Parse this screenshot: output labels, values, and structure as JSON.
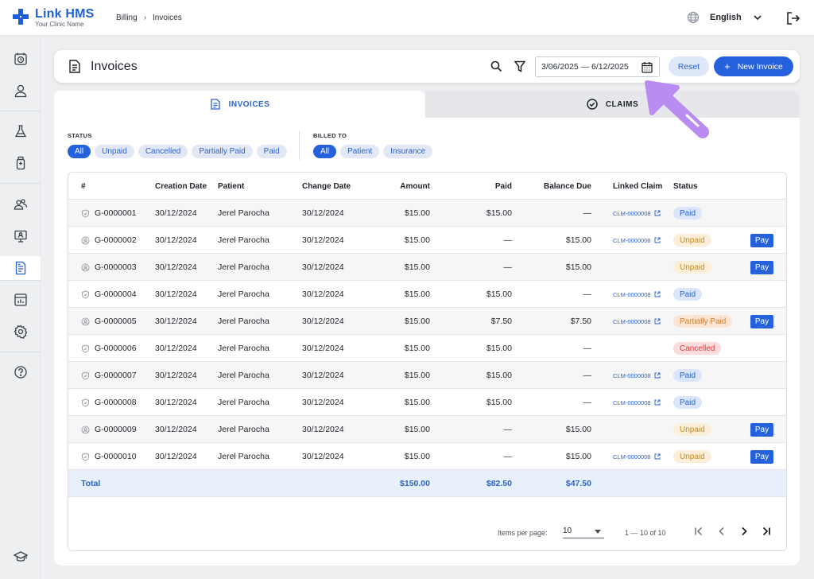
{
  "app": {
    "name": "Link HMS",
    "subtitle": "Your Clinic Name"
  },
  "breadcrumb": [
    "Billing",
    "Invoices"
  ],
  "language": "English",
  "page": {
    "title": "Invoices",
    "date_range": "3/06/2025 — 6/12/2025",
    "reset_label": "Reset",
    "new_invoice_label": "New Invoice"
  },
  "tabs": [
    {
      "label": "INVOICES",
      "active": true
    },
    {
      "label": "CLAIMS",
      "active": false
    }
  ],
  "filters": {
    "status": {
      "label": "STATUS",
      "options": [
        "All",
        "Unpaid",
        "Cancelled",
        "Partially Paid",
        "Paid"
      ],
      "selected": "All"
    },
    "billed_to": {
      "label": "BILLED TO",
      "options": [
        "All",
        "Patient",
        "Insurance"
      ],
      "selected": "All"
    }
  },
  "table": {
    "headers": [
      "#",
      "Creation Date",
      "Patient",
      "Change Date",
      "Amount",
      "Paid",
      "Balance Due",
      "Linked Claim",
      "Status"
    ],
    "pay_label": "Pay",
    "rows": [
      {
        "id": "G-0000001",
        "created": "30/12/2024",
        "patient": "Jerel Parocha",
        "changed": "30/12/2024",
        "amount": "$15.00",
        "paid": "$15.00",
        "balance": "—",
        "claim": "CLM-0000008",
        "status": "Paid",
        "billed": "insurance",
        "pay": false
      },
      {
        "id": "G-0000002",
        "created": "30/12/2024",
        "patient": "Jerel Parocha",
        "changed": "30/12/2024",
        "amount": "$15.00",
        "paid": "—",
        "balance": "$15.00",
        "claim": "CLM-0000008",
        "status": "Unpaid",
        "billed": "patient",
        "pay": true
      },
      {
        "id": "G-0000003",
        "created": "30/12/2024",
        "patient": "Jerel Parocha",
        "changed": "30/12/2024",
        "amount": "$15.00",
        "paid": "—",
        "balance": "$15.00",
        "claim": "",
        "status": "Unpaid",
        "billed": "patient",
        "pay": true
      },
      {
        "id": "G-0000004",
        "created": "30/12/2024",
        "patient": "Jerel Parocha",
        "changed": "30/12/2024",
        "amount": "$15.00",
        "paid": "$15.00",
        "balance": "—",
        "claim": "CLM-0000008",
        "status": "Paid",
        "billed": "insurance",
        "pay": false
      },
      {
        "id": "G-0000005",
        "created": "30/12/2024",
        "patient": "Jerel Parocha",
        "changed": "30/12/2024",
        "amount": "$15.00",
        "paid": "$7.50",
        "balance": "$7.50",
        "claim": "CLM-0000008",
        "status": "Partially Paid",
        "billed": "patient",
        "pay": true
      },
      {
        "id": "G-0000006",
        "created": "30/12/2024",
        "patient": "Jerel Parocha",
        "changed": "30/12/2024",
        "amount": "$15.00",
        "paid": "$15.00",
        "balance": "—",
        "claim": "",
        "status": "Cancelled",
        "billed": "insurance",
        "pay": false
      },
      {
        "id": "G-0000007",
        "created": "30/12/2024",
        "patient": "Jerel Parocha",
        "changed": "30/12/2024",
        "amount": "$15.00",
        "paid": "$15.00",
        "balance": "—",
        "claim": "CLM-0000008",
        "status": "Paid",
        "billed": "insurance",
        "pay": false
      },
      {
        "id": "G-0000008",
        "created": "30/12/2024",
        "patient": "Jerel Parocha",
        "changed": "30/12/2024",
        "amount": "$15.00",
        "paid": "$15.00",
        "balance": "—",
        "claim": "CLM-0000008",
        "status": "Paid",
        "billed": "insurance",
        "pay": false
      },
      {
        "id": "G-0000009",
        "created": "30/12/2024",
        "patient": "Jerel Parocha",
        "changed": "30/12/2024",
        "amount": "$15.00",
        "paid": "—",
        "balance": "$15.00",
        "claim": "",
        "status": "Unpaid",
        "billed": "patient",
        "pay": true
      },
      {
        "id": "G-0000010",
        "created": "30/12/2024",
        "patient": "Jerel Parocha",
        "changed": "30/12/2024",
        "amount": "$15.00",
        "paid": "—",
        "balance": "$15.00",
        "claim": "CLM-0000008",
        "status": "Unpaid",
        "billed": "insurance",
        "pay": true
      }
    ],
    "total": {
      "label": "Total",
      "amount": "$150.00",
      "paid": "$82.50",
      "balance": "$47.50"
    }
  },
  "pagination": {
    "items_per_page_label": "Items per page:",
    "items_per_page": "10",
    "range": "1 — 10 of 10"
  },
  "sidebar_icons": [
    "calendar-clock-icon",
    "user-icon",
    "flask-icon",
    "medicine-bottle-icon",
    "users-icon",
    "monitor-user-icon",
    "invoice-icon",
    "reports-icon",
    "settings-icon",
    "help-icon",
    "graduation-cap-icon"
  ],
  "colors": {
    "primary": "#2561dc",
    "accent_arrow": "#b98cf0",
    "paid": "#2b63c9",
    "unpaid": "#c38a23",
    "partially_paid": "#d27a2c",
    "cancelled": "#d23d3d"
  }
}
